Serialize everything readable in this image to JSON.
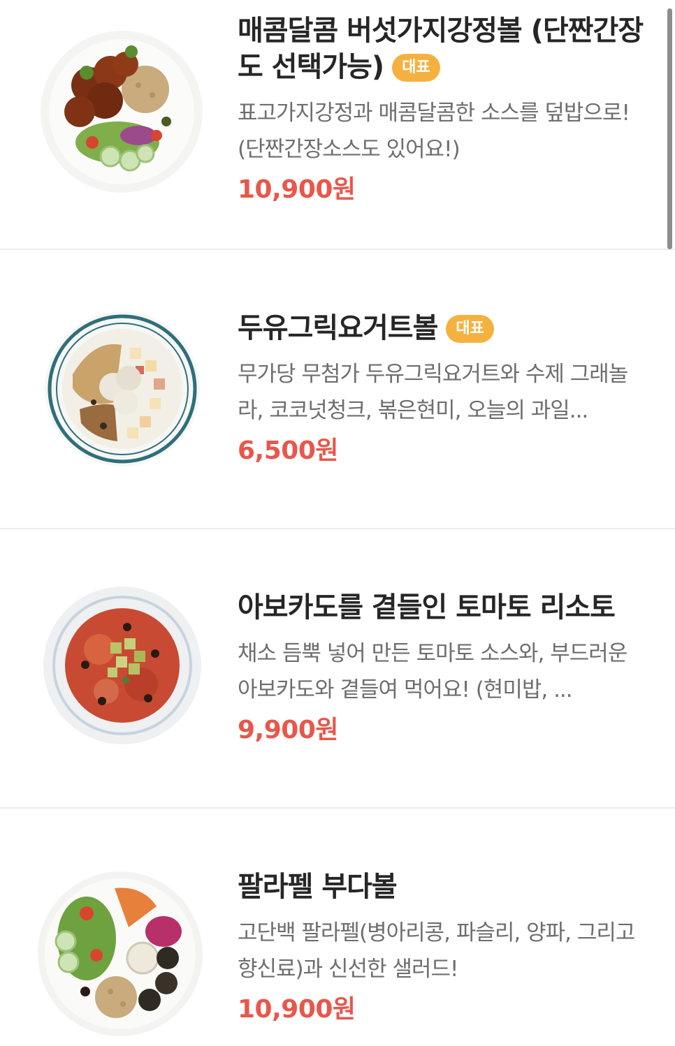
{
  "accent_colors": {
    "price": "#e8574b",
    "badge_bg": "#f5b13f",
    "badge_text": "#ffffff",
    "title": "#262626",
    "description": "#6e6e6e"
  },
  "items": [
    {
      "title": "매콤달콤 버섯가지강정볼 (단짠간장도 선택가능)",
      "badge": "대표",
      "description": "표고가지강정과 매콤달콤한 소스를 덮밥으로! (단짠간장소스도 있어요!)",
      "price": "10,900원",
      "image": "spicy-mushroom-eggplant-bowl-image"
    },
    {
      "title": "두유그릭요거트볼",
      "badge": "대표",
      "description": "무가당 무첨가 두유그릭요거트와 수제 그래놀라, 코코넛청크, 볶은현미, 오늘의 과일...",
      "price": "6,500원",
      "image": "soy-greek-yogurt-bowl-image"
    },
    {
      "title": "아보카도를 곁들인 토마토 리소토",
      "badge": "",
      "description": "채소 듬뿍 넣어 만든 토마토 소스와, 부드러운 아보카도와 곁들여 먹어요! (현미밥, ...",
      "price": "9,900원",
      "image": "avocado-tomato-risotto-image"
    },
    {
      "title": "팔라펠 부다볼",
      "badge": "",
      "description": "고단백 팔라펠(병아리콩, 파슬리, 양파, 그리고 향신료)과 신선한 샐러드!",
      "price": "10,900원",
      "image": "falafel-buddha-bowl-image"
    }
  ]
}
